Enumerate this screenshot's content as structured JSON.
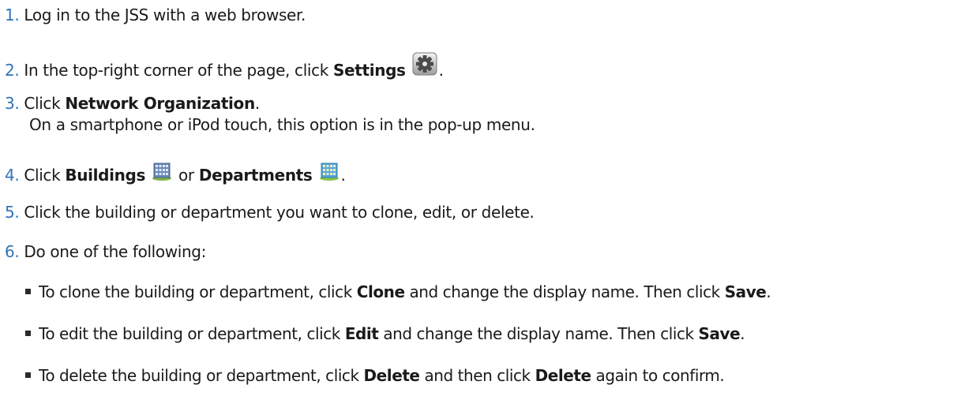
{
  "steps": [
    {
      "num": "1.",
      "text": "Log in to the JSS with a web browser."
    },
    {
      "num": "2.",
      "pre": "In the top-right corner of the page, click ",
      "bold": "Settings",
      "icon": "gear-icon",
      "post": "."
    },
    {
      "num": "3.",
      "pre": "Click ",
      "bold": "Network Organization",
      "post": ".",
      "sub": "On a smartphone or iPod touch, this option is in the pop-up menu."
    },
    {
      "num": "4.",
      "pre": "Click ",
      "bold": "Buildings",
      "icon": "building-icon",
      "mid": " or ",
      "bold2": "Departments",
      "icon2": "departments-icon",
      "post": "."
    },
    {
      "num": "5.",
      "text": "Click the building or department you want to clone, edit, or delete."
    },
    {
      "num": "6.",
      "text": "Do one of the following:"
    }
  ],
  "bullets": [
    {
      "pre": "To clone the building or department, click ",
      "bold": "Clone",
      "mid": " and change the display name. Then click ",
      "bold2": "Save",
      "post": "."
    },
    {
      "pre": "To edit the building or department, click ",
      "bold": "Edit",
      "mid": " and change the display name. Then click ",
      "bold2": "Save",
      "post": "."
    },
    {
      "pre": "To delete the building or department, click ",
      "bold": "Delete",
      "mid": " and then click ",
      "bold2": "Delete",
      "post": " again to confirm."
    }
  ],
  "colors": {
    "number": "#2f74b8",
    "text": "#1a1a1a"
  }
}
